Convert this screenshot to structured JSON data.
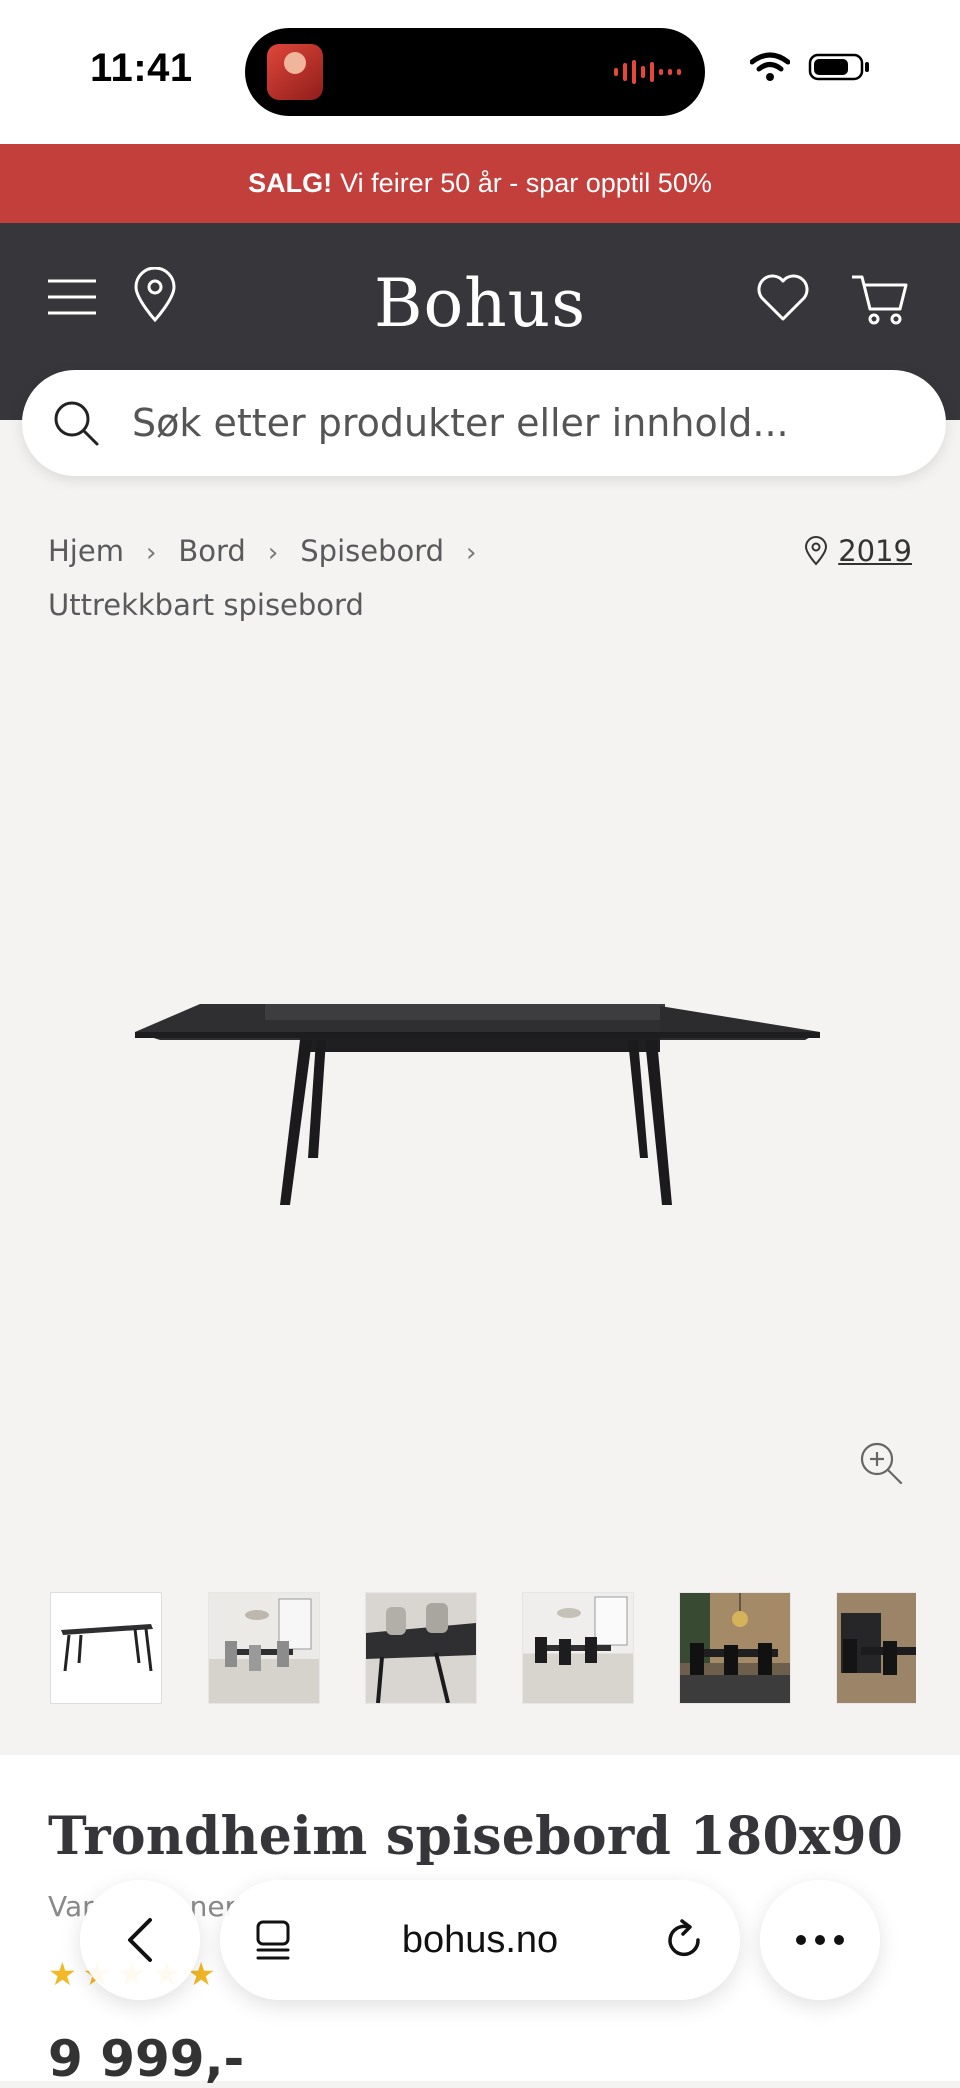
{
  "status_bar": {
    "time": "11:41"
  },
  "promo": {
    "bold": "SALG!",
    "text": "Vi feirer 50 år - spar opptil 50%"
  },
  "header": {
    "logo": "Bohus"
  },
  "search": {
    "placeholder": "Søk etter produkter eller innhold..."
  },
  "breadcrumb": {
    "items": [
      "Hjem",
      "Bord",
      "Spisebord",
      "Uttrekkbart spisebord"
    ]
  },
  "store": {
    "label": "2019"
  },
  "product": {
    "title": "Trondheim spisebord 180x90",
    "variant_prefix": "Var",
    "variant_suffix": "ner",
    "rating_stars": 5,
    "price": "9 999,-"
  },
  "browser": {
    "url": "bohus.no"
  },
  "colors": {
    "promo": "#c23f3b",
    "header": "#37373b",
    "page_bg": "#f4f3f1"
  }
}
